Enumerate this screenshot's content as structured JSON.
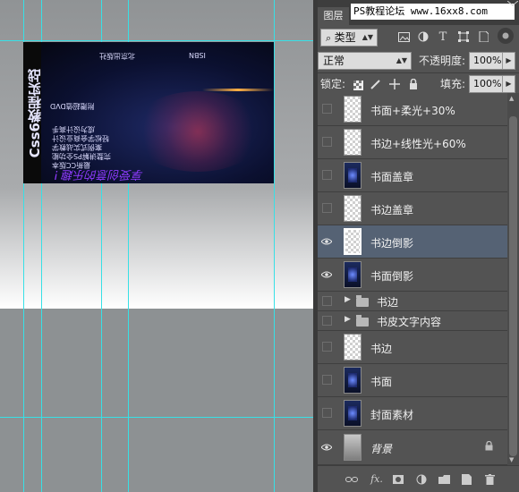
{
  "panel": {
    "tab_label": "图层",
    "watermark": "PS教程论坛 www.16xx8.com",
    "filter_kind": "类型",
    "blend_mode": "正常",
    "opacity_label": "不透明度:",
    "opacity_value": "100%",
    "lock_label": "锁定:",
    "fill_label": "填充:",
    "fill_value": "100%"
  },
  "layers": [
    {
      "name": "书面+柔光+30%",
      "visible": false,
      "thumb": "checker"
    },
    {
      "name": "书边+线性光+60%",
      "visible": false,
      "thumb": "checker"
    },
    {
      "name": "书面盖章",
      "visible": false,
      "thumb": "dark"
    },
    {
      "name": "书边盖章",
      "visible": false,
      "thumb": "checker"
    },
    {
      "name": "书边倒影",
      "visible": true,
      "selected": true,
      "thumb": "checker"
    },
    {
      "name": "书面倒影",
      "visible": true,
      "thumb": "dark"
    },
    {
      "name": "书边",
      "visible": false,
      "group": true
    },
    {
      "name": "书皮文字内容",
      "visible": false,
      "group": true
    },
    {
      "name": "书边",
      "visible": false,
      "thumb": "checker"
    },
    {
      "name": "书面",
      "visible": false,
      "thumb": "dark"
    },
    {
      "name": "封面素材",
      "visible": false,
      "thumb": "dark"
    },
    {
      "name": "背景",
      "visible": true,
      "thumb": "gray",
      "locked": true,
      "italic": true
    }
  ],
  "book": {
    "spine_text": "Css6教程实战",
    "lines": [
      "成为设计高手",
      "轻松学会商业设计",
      "案例式实战教学",
      "完整讲解PS全功能",
      "最新CC版本"
    ],
    "disc_label": "附赠超值DVD",
    "signature": "享受创意的乐趣 !",
    "publisher": "北京出版社",
    "barcode": "ISBN"
  },
  "colors": {
    "guide": "#37e0e6",
    "panel_bg": "#535353",
    "selected_row": "#556274"
  }
}
